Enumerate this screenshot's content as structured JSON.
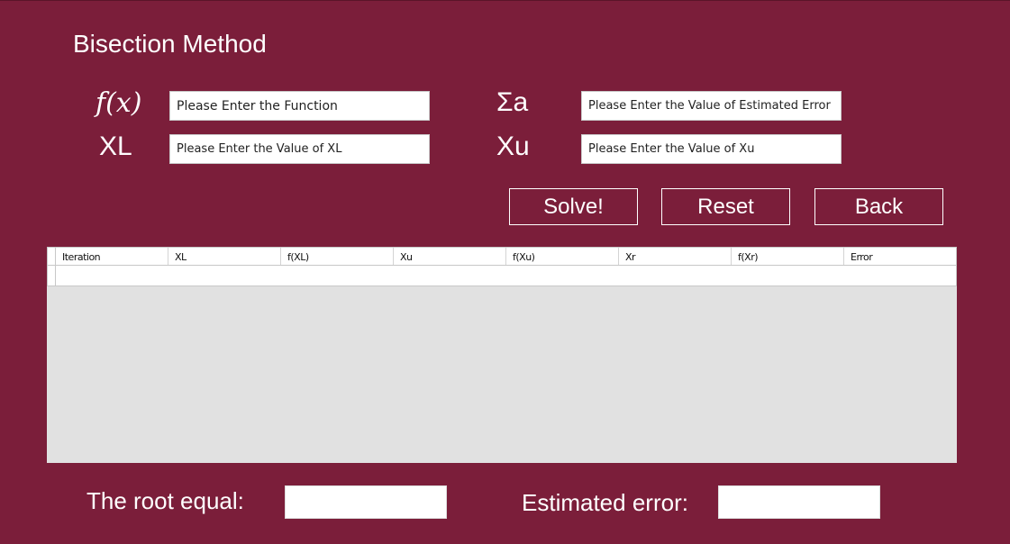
{
  "window": {
    "title": "Bisection Method"
  },
  "inputs": {
    "function": {
      "label": "f(x)",
      "placeholder": "Please Enter the Function",
      "value": ""
    },
    "xl": {
      "label": "XL",
      "placeholder": "Please Enter the Value of XL",
      "value": ""
    },
    "estimated_error": {
      "label": "Σa",
      "placeholder": "Please Enter the Value of Estimated Error",
      "value": ""
    },
    "xu": {
      "label": "Xu",
      "placeholder": "Please Enter the Value of Xu",
      "value": ""
    }
  },
  "buttons": {
    "solve": "Solve!",
    "reset": "Reset",
    "back": "Back"
  },
  "table": {
    "columns": [
      "Iteration",
      "XL",
      "f(XL)",
      "Xu",
      "f(Xu)",
      "Xr",
      "f(Xr)",
      "Error"
    ],
    "rows": []
  },
  "results": {
    "root_label": "The root equal:",
    "root_value": "",
    "error_label": "Estimated error:",
    "error_value": ""
  }
}
